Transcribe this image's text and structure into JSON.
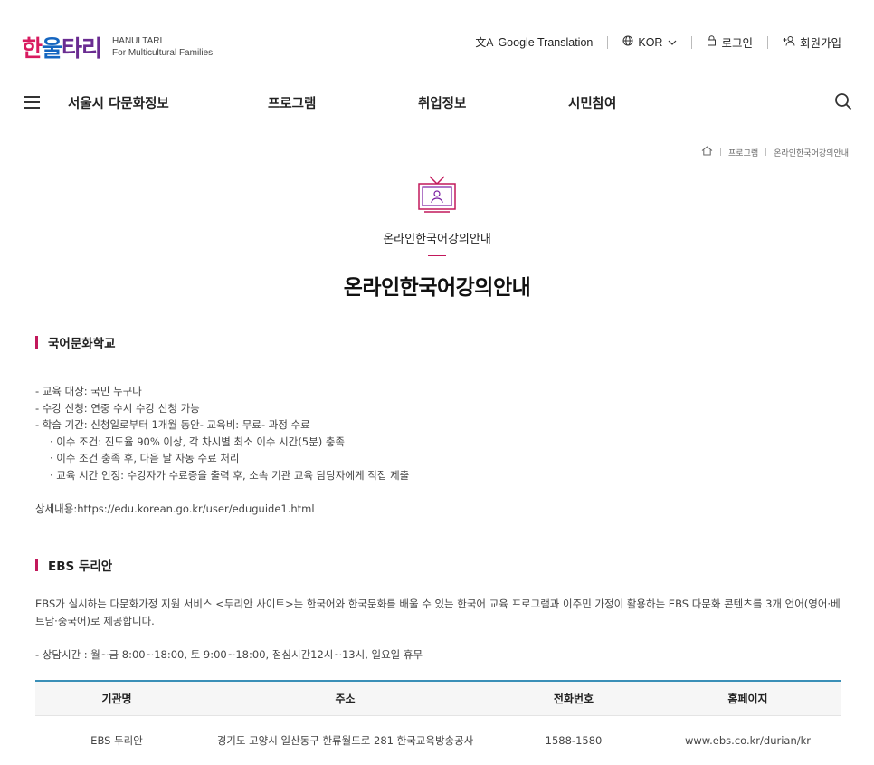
{
  "header": {
    "logo_ko_1": "한",
    "logo_ko_2": "울",
    "logo_ko_3": "타리",
    "logo_en_1": "HANULTARI",
    "logo_en_2": "For Multicultural Families",
    "util": {
      "translate": "Google Translation",
      "lang": "KOR",
      "login": "로그인",
      "signup": "회원가입"
    }
  },
  "nav": {
    "items": [
      "서울시 다문화정보",
      "프로그램",
      "취업정보",
      "시민참여"
    ]
  },
  "breadcrumb": {
    "level1": "프로그램",
    "level2": "온라인한국어강의안내"
  },
  "page": {
    "subtitle": "온라인한국어강의안내",
    "title": "온라인한국어강의안내"
  },
  "section1": {
    "heading": "국어문화학교",
    "lines": [
      "- 교육 대상: 국민 누구나",
      "- 수강 신청: 연중 수시 수강 신청 가능",
      "- 학습 기간: 신청일로부터 1개월 동안- 교육비: 무료- 과정 수료",
      "· 이수 조건: 진도율 90% 이상, 각 차시별 최소 이수 시간(5분) 충족",
      "· 이수 조건 충족 후, 다음 날 자동 수료 처리",
      "· 교육 시간 인정: 수강자가 수료증을 출력 후, 소속 기관 교육 담당자에게 직접 제출"
    ],
    "detail": "상세내용:https://edu.korean.go.kr/user/eduguide1.html"
  },
  "section2": {
    "heading": "EBS 두리안",
    "para": "EBS가 실시하는 다문화가정 지원 서비스 <두리안 사이트>는 한국어와 한국문화를 배울 수 있는 한국어 교육 프로그램과 이주민 가정이 활용하는 EBS 다문화 콘텐츠를 3개 언어(영어·베트남·중국어)로 제공합니다.",
    "hours": "- 상담시간 : 월~금 8:00~18:00, 토 9:00~18:00, 점심시간12시~13시, 일요일 휴무"
  },
  "table": {
    "headers": [
      "기관명",
      "주소",
      "전화번호",
      "홈페이지"
    ],
    "rows": [
      [
        "EBS 두리안",
        "경기도 고양시 일산동구 한류월드로 281 한국교육방송공사",
        "1588-1580",
        "www.ebs.co.kr/durian/kr"
      ]
    ]
  },
  "colors": {
    "accent": "#c2185b",
    "table_top": "#3a8fb7"
  }
}
